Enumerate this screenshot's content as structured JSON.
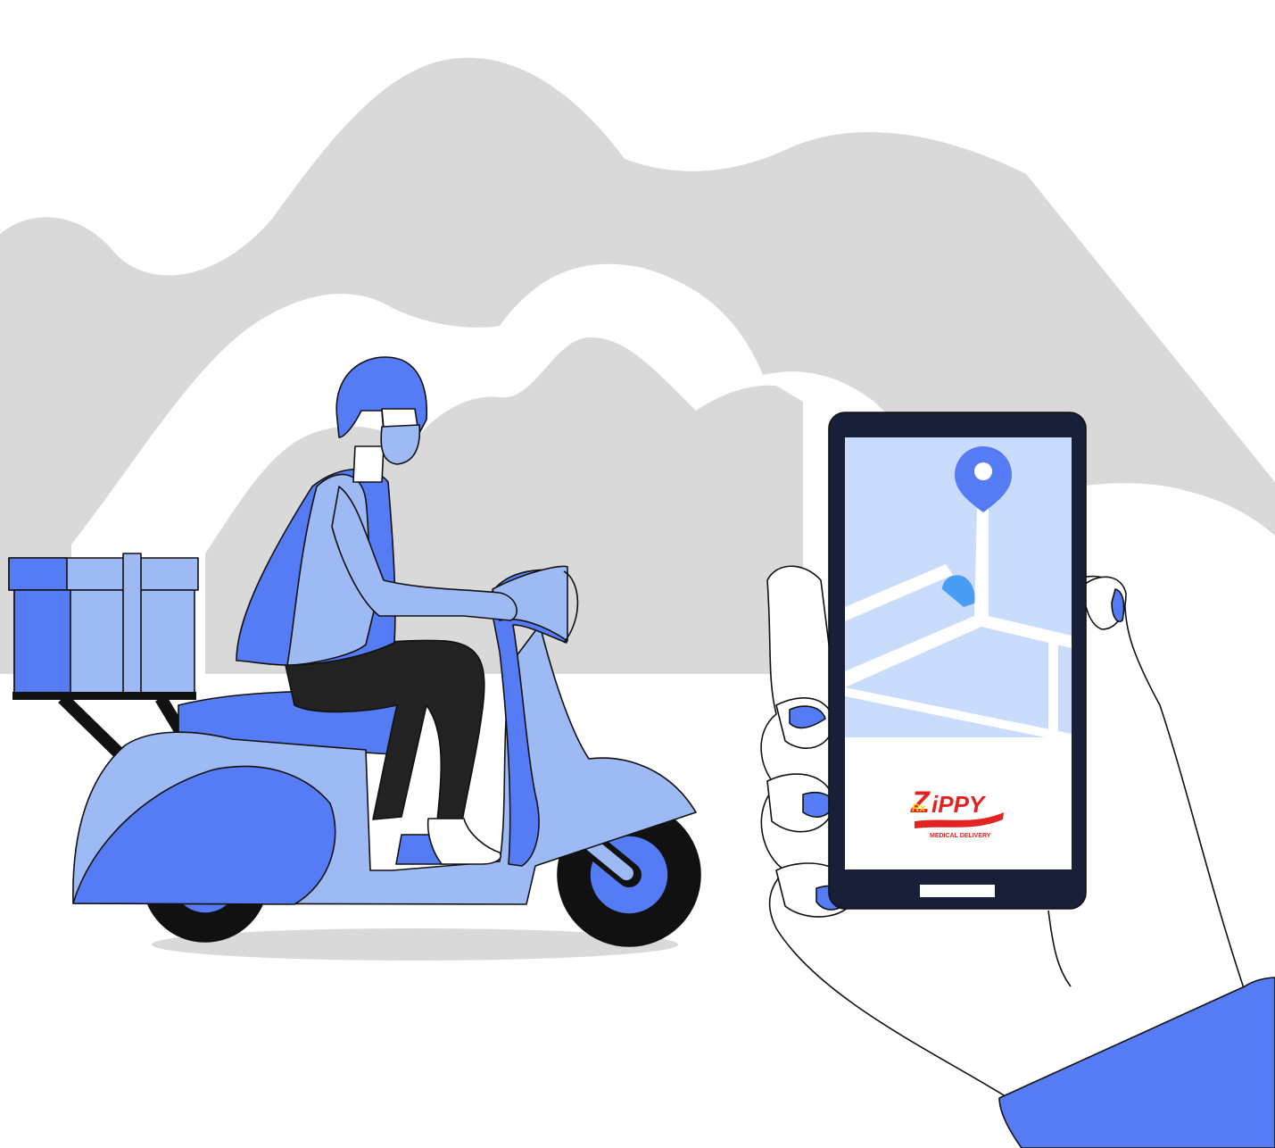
{
  "brand": {
    "name": "ZiPPY",
    "name_lead": "Z",
    "name_rest": "iPPY",
    "rx_mark": "Rx",
    "tagline": "MEDICAL DELIVERY",
    "color_primary": "#e3231f",
    "color_accent": "#f7d117"
  },
  "palette": {
    "background": "#ffffff",
    "mountains": "#d9d9d9",
    "blue_dark": "#567cf5",
    "blue_light": "#9dbaf4",
    "map_bg": "#c9dcfb",
    "phone_body": "#172038",
    "outline": "#111111"
  },
  "icons": {
    "map_pin": "location-pin-icon",
    "user_location": "navigation-arrow-icon",
    "home_button": "home-button-icon"
  }
}
